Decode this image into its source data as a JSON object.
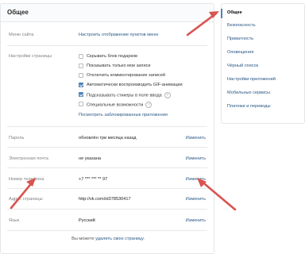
{
  "main": {
    "title": "Общее",
    "site_menu": {
      "label": "Меню сайта",
      "link": "Настроить отображение пунктов меню"
    },
    "page_settings": {
      "label": "Настройки страницы",
      "options": [
        {
          "text": "Скрывать блок подарков",
          "checked": false,
          "help": false
        },
        {
          "text": "Показывать только мои записи",
          "checked": false,
          "help": false
        },
        {
          "text": "Отключить комментирование записей",
          "checked": false,
          "help": false
        },
        {
          "text": "Автоматически воспроизводить GIF-анимации",
          "checked": true,
          "help": false
        },
        {
          "text": "Подсказывать стикеры в поле ввода",
          "checked": true,
          "help": true
        },
        {
          "text": "Специальные возможности",
          "checked": false,
          "help": true
        }
      ],
      "blocked_apps_link": "Посмотреть заблокированные приложения"
    },
    "password": {
      "label": "Пароль",
      "value": "обновлён три месяца назад",
      "action": "Изменить"
    },
    "email": {
      "label": "Электронная почта",
      "value": "не указана",
      "action": "Изменить"
    },
    "phone": {
      "label": "Номер телефона",
      "value": "+7 *** *** ** 97",
      "action": "Изменить"
    },
    "page_address": {
      "label": "Адрес страницы",
      "value": "http://vk.com/id378530417",
      "action": "Изменить"
    },
    "language": {
      "label": "Язык",
      "value": "Русский",
      "action": "Изменить"
    },
    "footer": {
      "text": "Вы можете",
      "link": "удалить свою страницу."
    }
  },
  "sidebar": {
    "items": [
      {
        "label": "Общее",
        "active": true
      },
      {
        "label": "Безопасность",
        "active": false
      },
      {
        "label": "Приватность",
        "active": false
      },
      {
        "label": "Оповещения",
        "active": false
      },
      {
        "label": "Чёрный список",
        "active": false
      },
      {
        "label": "Настройки приложений",
        "active": false
      },
      {
        "label": "Мобильные сервисы",
        "active": false
      },
      {
        "label": "Платежи и переводы",
        "active": false
      }
    ]
  },
  "colors": {
    "accent": "#2a5885",
    "arrow": "#d9534f",
    "checkbox_on": "#5181b8"
  }
}
